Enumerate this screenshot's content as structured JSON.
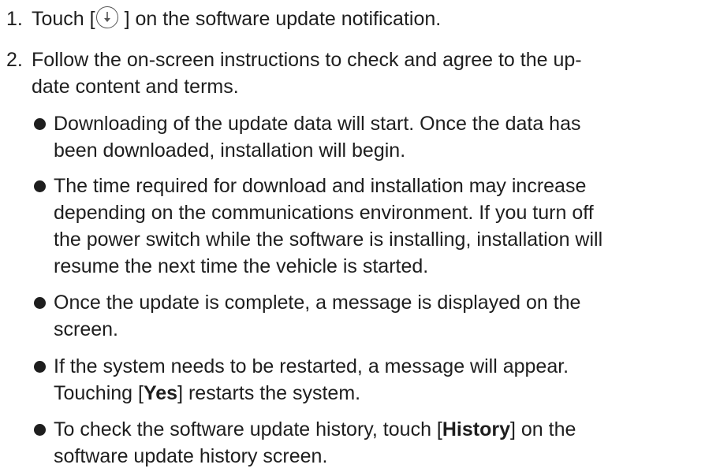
{
  "steps": [
    {
      "number": "1.",
      "text_before": "Touch [",
      "icon": "download-arrow-icon",
      "text_after": "] on the software update notification."
    },
    {
      "number": "2.",
      "line1": "Follow the on-screen instructions to check and agree to the up-",
      "line2": "date content and terms."
    }
  ],
  "bullets": [
    {
      "line1": "Downloading of the update data will start. Once the data has",
      "line2": "been downloaded, installation will begin."
    },
    {
      "line1": "The time required for download and installation may increase",
      "line2": "depending on the communications environment. If you turn off",
      "line3": "the power switch while the software is installing, installation will",
      "line4": "resume the next time the vehicle is started."
    },
    {
      "line1": "Once the update is complete, a message is displayed on the",
      "line2": "screen."
    },
    {
      "line1": "If the system needs to be restarted, a message will appear.",
      "line2_before": "Touching [",
      "line2_bold": "Yes",
      "line2_after": "] restarts the system."
    },
    {
      "line1_before": "To check the software update history, touch [",
      "line1_bold": "History",
      "line1_after": "] on the",
      "line2": "software update history screen."
    }
  ]
}
